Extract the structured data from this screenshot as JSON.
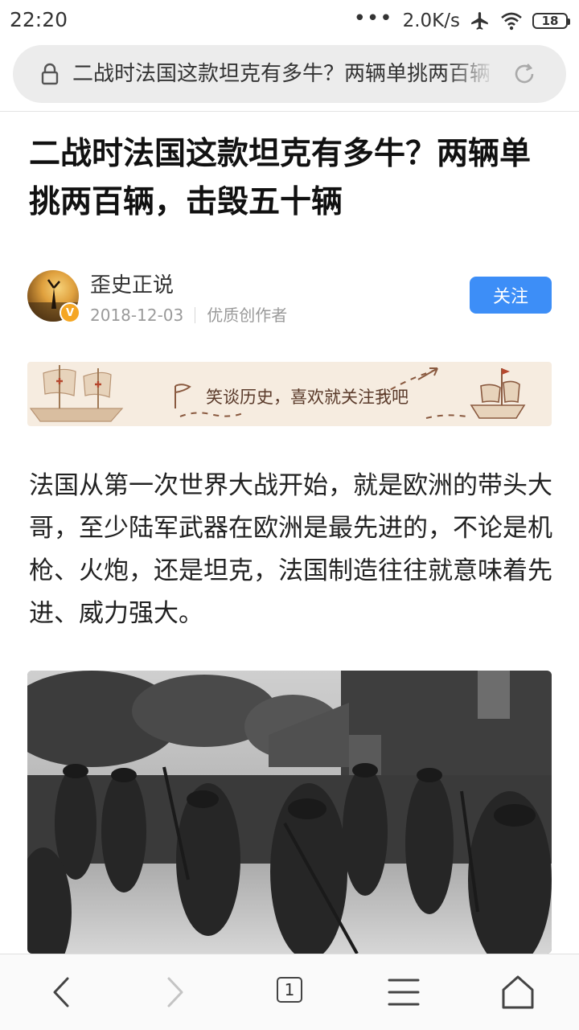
{
  "status": {
    "time": "22:20",
    "dots": "•••",
    "speed": "2.0K/s",
    "battery": "18"
  },
  "url_bar": {
    "text": "二战时法国这款坦克有多牛？两辆单挑两百辆，击毁五十辆"
  },
  "article": {
    "title": "二战时法国这款坦克有多牛？两辆单挑两百辆，击毁五十辆",
    "author": {
      "name": "歪史正说",
      "date": "2018-12-03",
      "tag": "优质创作者",
      "badge": "V"
    },
    "follow_label": "关注",
    "banner_text": "笑谈历史，喜欢就关注我吧",
    "paragraph": "法国从第一次世界大战开始，就是欧洲的带头大哥，至少陆军武器在欧洲是最先进的，不论是机枪、火炮，还是坦克，法国制造往往就意味着先进、威力强大。"
  },
  "bottom_nav": {
    "tab_count": "1",
    "icons": [
      "back-icon",
      "forward-icon",
      "tabs-icon",
      "menu-icon",
      "home-icon"
    ]
  },
  "colors": {
    "accent": "#3d8ef7",
    "badge": "#f5a623",
    "banner_bg": "#f6ece0"
  }
}
